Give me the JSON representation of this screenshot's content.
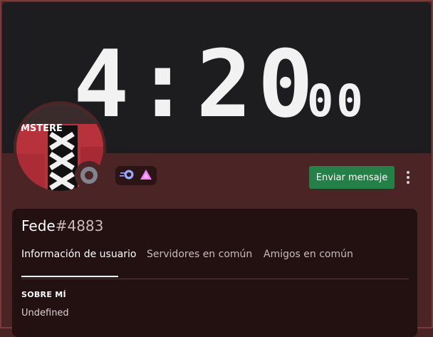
{
  "banner": {
    "clock_main": "4:20",
    "clock_seconds": "00"
  },
  "profile": {
    "username": "Fede",
    "discriminator": "#4883",
    "send_message_label": "Enviar mensaje",
    "status": "offline",
    "avatar_text": "MSTERE"
  },
  "tabs": [
    {
      "label": "Información de usuario",
      "active": true
    },
    {
      "label": "Servidores en común",
      "active": false
    },
    {
      "label": "Amigos en común",
      "active": false
    }
  ],
  "about": {
    "title": "SOBRE MÍ",
    "text": "Undefined"
  },
  "colors": {
    "accent_green": "#248046",
    "banner_bg": "#1d1d1f",
    "card_bg": "#231010",
    "frame_bg": "#4b2526"
  },
  "icons": [
    "more-options-icon",
    "nitro-badge-icon",
    "hypesquad-badge-icon",
    "status-offline-icon"
  ]
}
